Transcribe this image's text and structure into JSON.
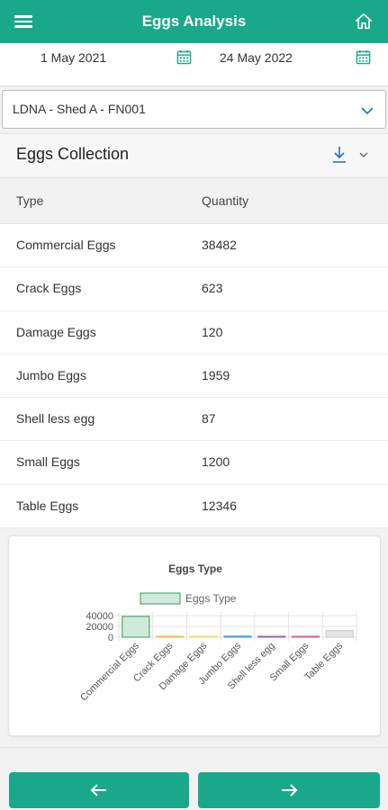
{
  "header": {
    "title": "Eggs Analysis",
    "menu_icon": "hamburger-menu-icon",
    "home_icon": "home-icon"
  },
  "dates": {
    "start": "1 May 2021",
    "end": "24 May 2022",
    "calendar_icon": "calendar-icon"
  },
  "location_select": {
    "value": "LDNA - Shed A - FN001"
  },
  "section": {
    "title": "Eggs Collection",
    "download_icon": "download-icon"
  },
  "table": {
    "headers": [
      "Type",
      "Quantity"
    ],
    "rows": [
      {
        "type": "Commercial Eggs",
        "quantity": "38482"
      },
      {
        "type": "Crack Eggs",
        "quantity": "623"
      },
      {
        "type": "Damage Eggs",
        "quantity": "120"
      },
      {
        "type": "Jumbo Eggs",
        "quantity": "1959"
      },
      {
        "type": "Shell less egg",
        "quantity": "87"
      },
      {
        "type": "Small Eggs",
        "quantity": "1200"
      },
      {
        "type": "Table Eggs",
        "quantity": "12346"
      }
    ]
  },
  "colors": {
    "primary": "#1aa88a"
  },
  "chart_data": {
    "type": "bar",
    "title": "Eggs Type",
    "categories": [
      "Commercial Eggs",
      "Crack Eggs",
      "Damage Eggs",
      "Jumbo Eggs",
      "Shell less egg",
      "Small Eggs",
      "Table Eggs"
    ],
    "series": [
      {
        "name": "Eggs Type",
        "values": [
          38482,
          623,
          120,
          1959,
          87,
          1200,
          12346
        ]
      }
    ],
    "bar_colors": [
      "#2e9e5e",
      "#ffb04a",
      "#f6d860",
      "#3b8fd6",
      "#9b59b6",
      "#e05a7a",
      "#c8c8c8"
    ],
    "bar_fills": [
      "#cfe9da",
      "#fff0db",
      "#fcf6da",
      "#d8e9f7",
      "#ece1f2",
      "#f9dfe5",
      "#e6e6e6"
    ],
    "yticks": [
      "40000",
      "20000",
      "0"
    ],
    "ylim": [
      0,
      40000
    ],
    "legend_position": "top",
    "grid": true
  },
  "nav": {
    "back_icon": "arrow-left-icon",
    "next_icon": "arrow-right-icon"
  }
}
